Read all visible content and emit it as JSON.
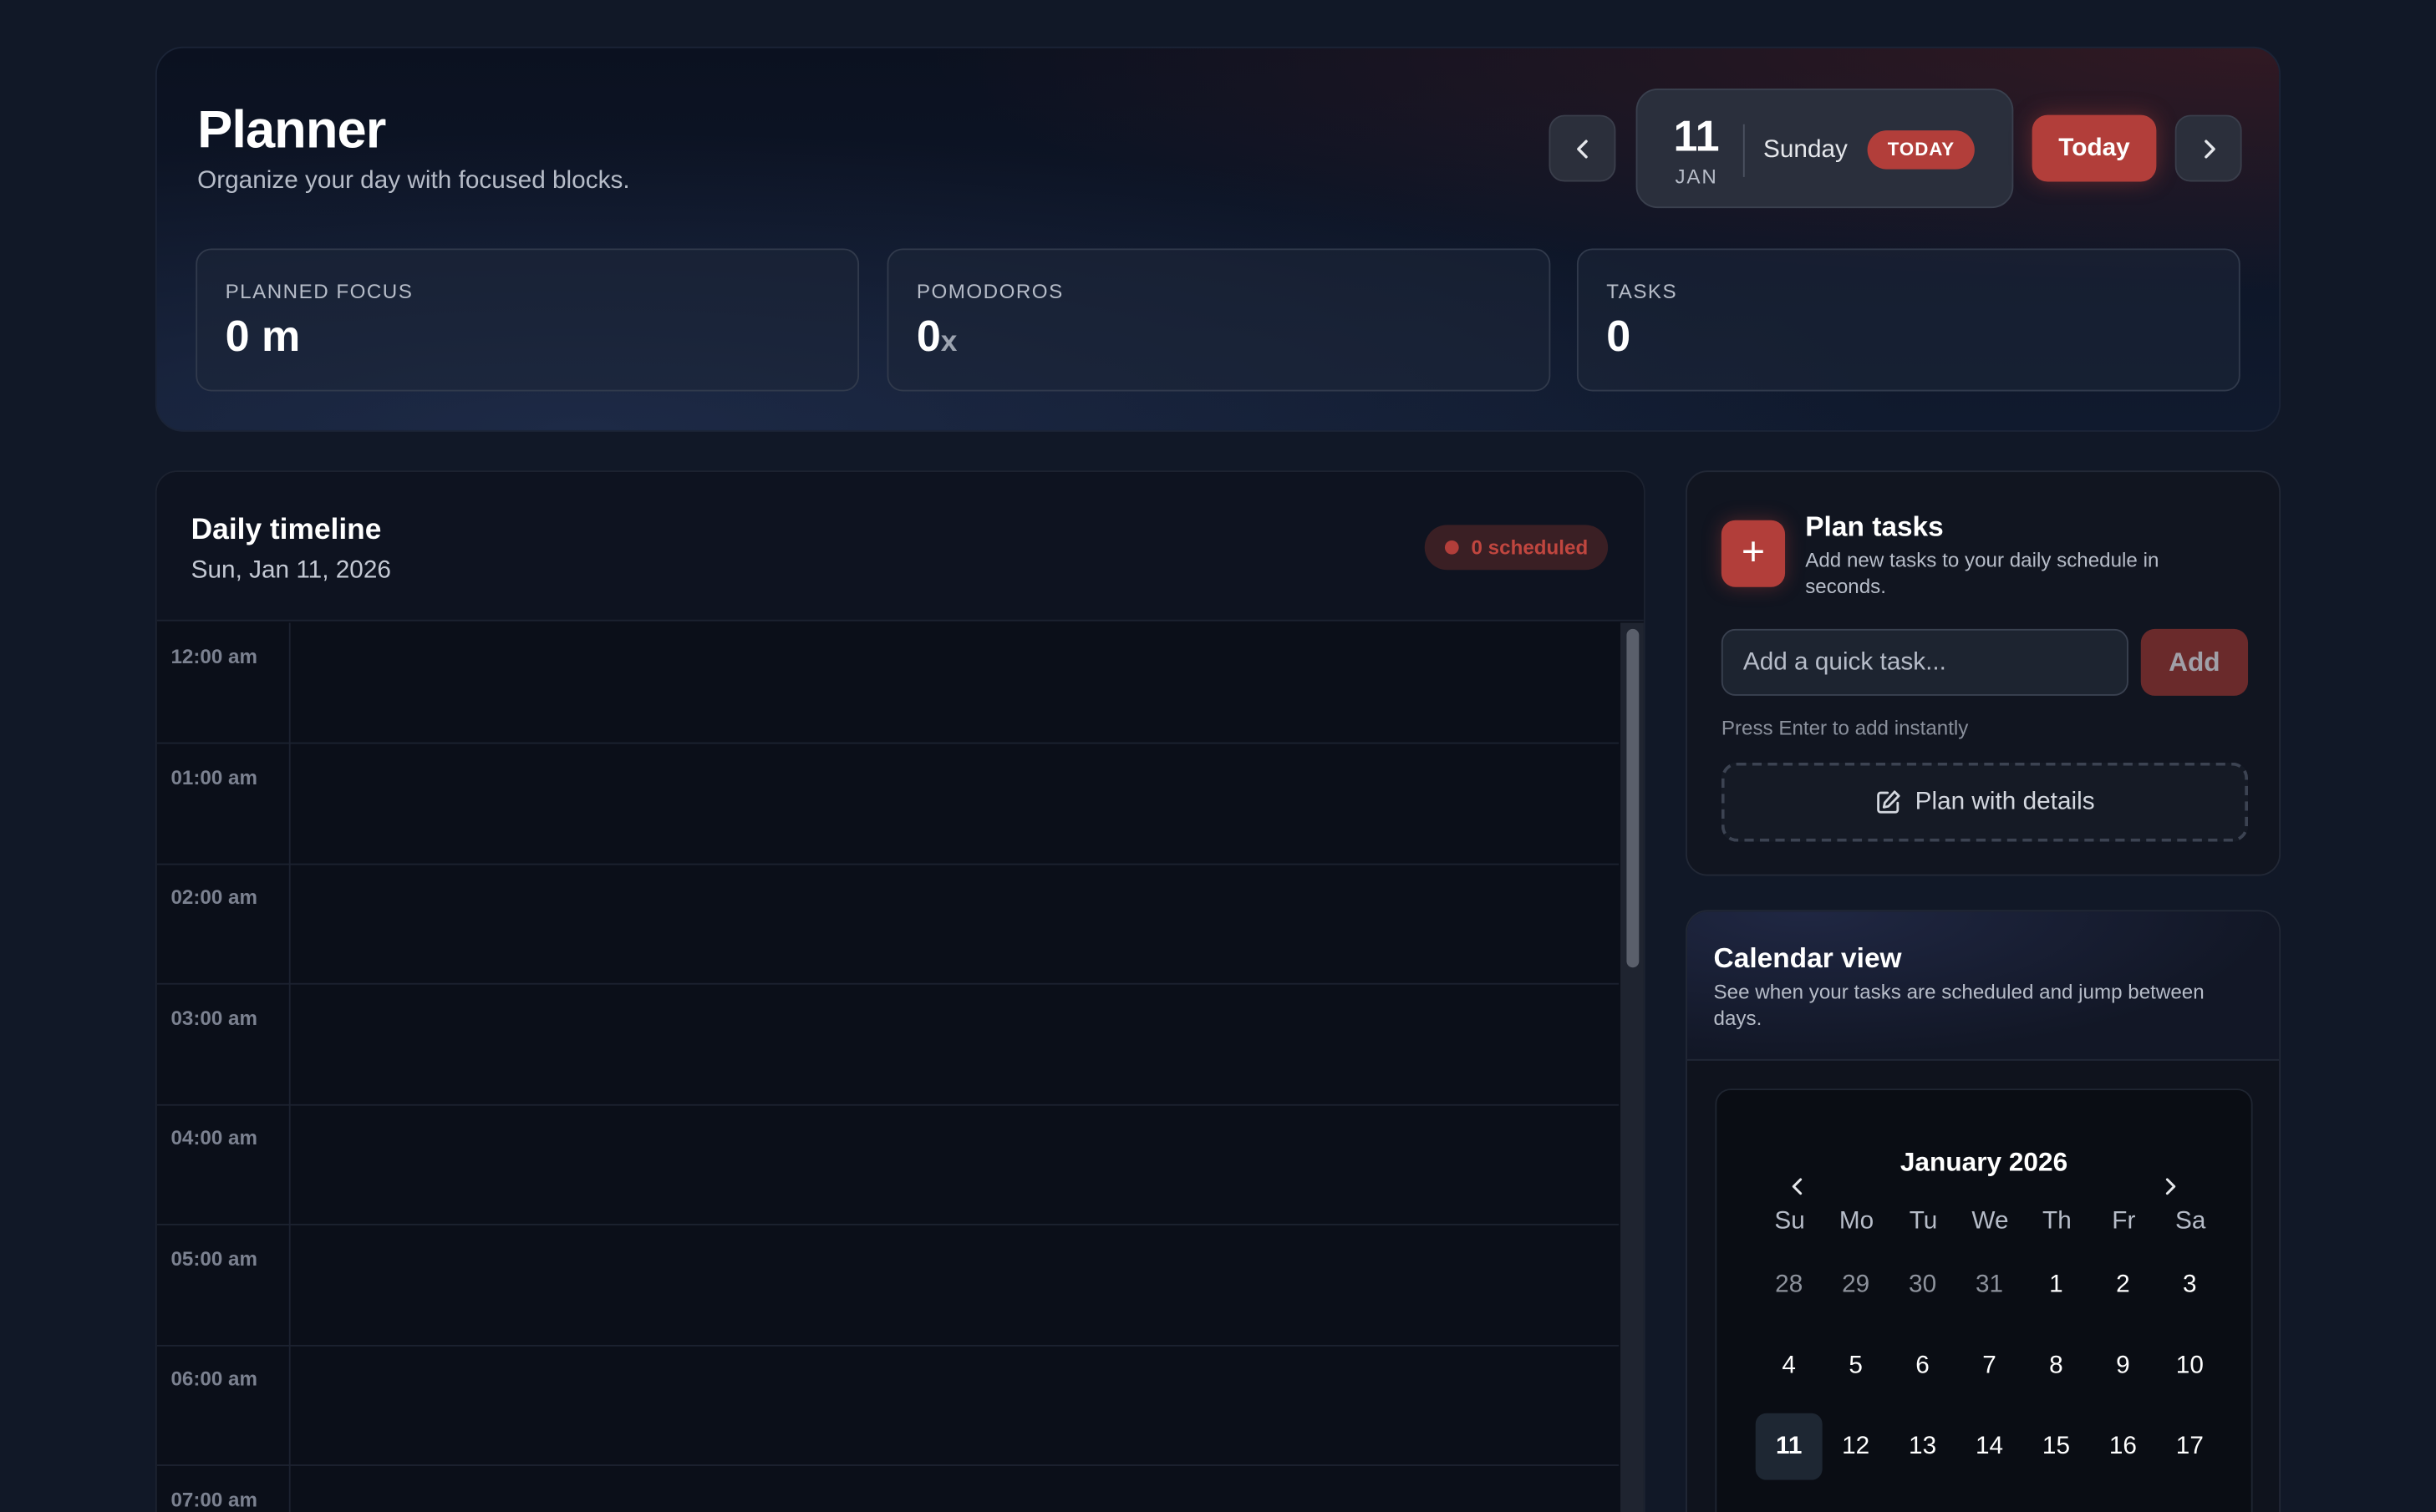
{
  "header": {
    "title": "Planner",
    "subtitle": "Organize your day with focused blocks.",
    "prev_icon": "chevron-left",
    "next_icon": "chevron-right",
    "date": {
      "day_number": "11",
      "month": "JAN",
      "weekday": "Sunday",
      "badge": "TODAY"
    },
    "today_button": "Today"
  },
  "stats": [
    {
      "label": "PLANNED FOCUS",
      "value": "0 m",
      "unit": ""
    },
    {
      "label": "POMODOROS",
      "value": "0",
      "unit": "x"
    },
    {
      "label": "TASKS",
      "value": "0",
      "unit": ""
    }
  ],
  "timeline": {
    "title": "Daily timeline",
    "date": "Sun, Jan 11, 2026",
    "scheduled_badge": "0 scheduled",
    "hours": [
      "12:00 am",
      "01:00 am",
      "02:00 am",
      "03:00 am",
      "04:00 am",
      "05:00 am",
      "06:00 am",
      "07:00 am"
    ]
  },
  "plan": {
    "title": "Plan tasks",
    "subtitle": "Add new tasks to your daily schedule in seconds.",
    "input_placeholder": "Add a quick task...",
    "add_button": "Add",
    "hint": "Press Enter to add instantly",
    "details_button": "Plan with details"
  },
  "calendar": {
    "title": "Calendar view",
    "subtitle": "See when your tasks are scheduled and jump between days.",
    "month_label": "January 2026",
    "weekdays": [
      "Su",
      "Mo",
      "Tu",
      "We",
      "Th",
      "Fr",
      "Sa"
    ],
    "weeks": [
      [
        "28",
        "29",
        "30",
        "31",
        "1",
        "2",
        "3"
      ],
      [
        "4",
        "5",
        "6",
        "7",
        "8",
        "9",
        "10"
      ],
      [
        "11",
        "12",
        "13",
        "14",
        "15",
        "16",
        "17"
      ]
    ],
    "muted_days_first_week": 4,
    "selected_day": "11"
  },
  "colors": {
    "accent": "#b23e3a",
    "background": "#111827",
    "panel": "#0b0f19"
  }
}
